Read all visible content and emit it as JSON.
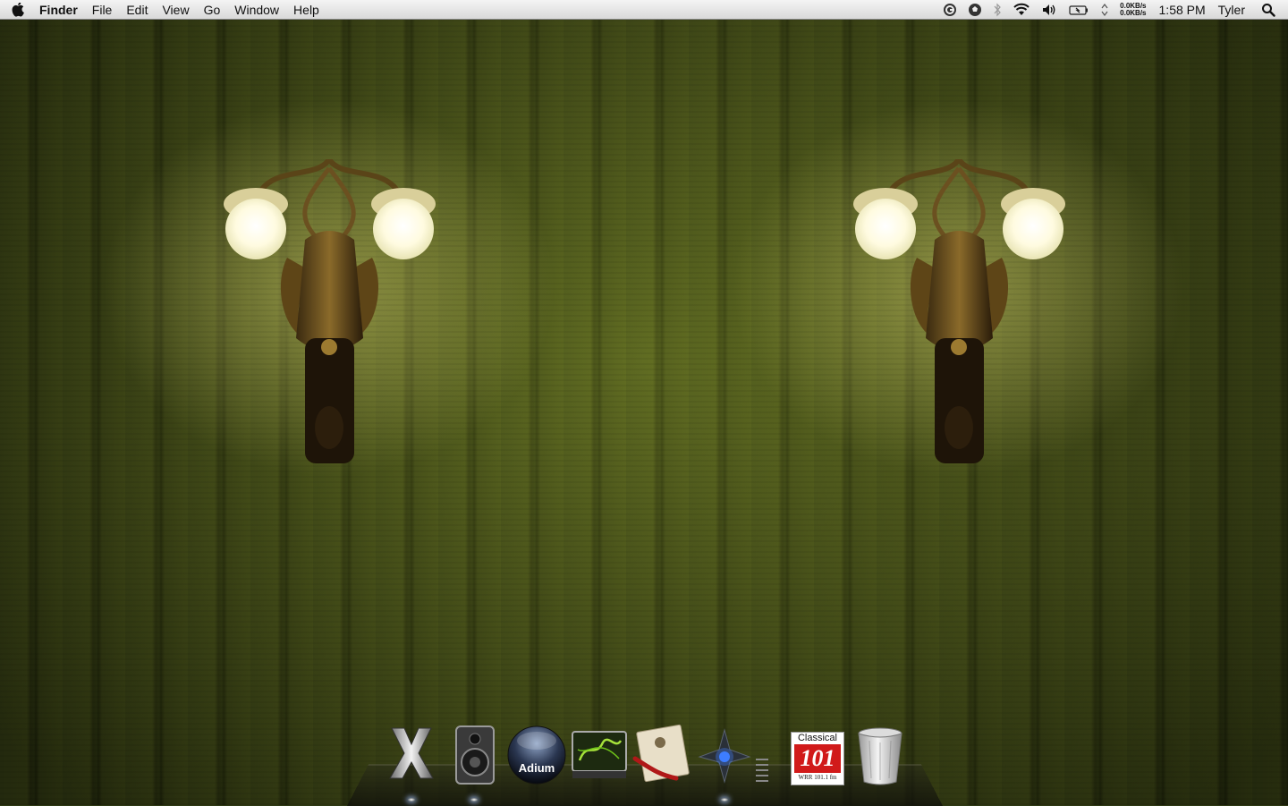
{
  "menubar": {
    "app_name": "Finder",
    "menus": [
      "File",
      "Edit",
      "View",
      "Go",
      "Window",
      "Help"
    ],
    "net_up": "0.0KB/s",
    "net_down": "0.0KB/s",
    "clock": "1:58 PM",
    "user": "Tyler"
  },
  "dock": {
    "adium_label": "Adium",
    "radio_label_top": "Classical",
    "radio_label_num": "101",
    "radio_label_bottom": "WRR 101.1 fm"
  }
}
